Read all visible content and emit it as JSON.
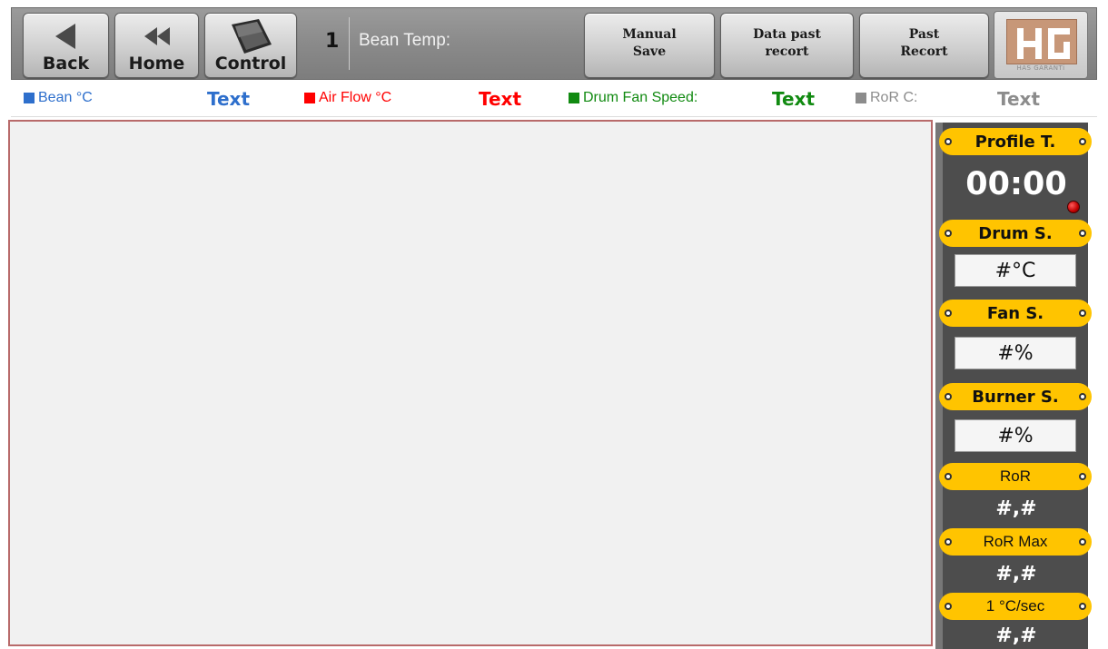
{
  "toolbar": {
    "back_label": "Back",
    "home_label": "Home",
    "control_label": "Control",
    "counter": "1",
    "bean_temp_label": "Bean Temp:",
    "manual_save_label": "Manual\nSave",
    "data_past_label": "Data past\nrecort",
    "past_record_label": "Past\nRecort",
    "logo_brand": "HAS GARANTi"
  },
  "legend": [
    {
      "label": "Bean °C",
      "value": "Text",
      "color": "#2e6fcc"
    },
    {
      "label": "Air Flow °C",
      "value": "Text",
      "color": "#ff0000"
    },
    {
      "label": "Drum Fan Speed:",
      "value": "Text",
      "color": "#118a11"
    },
    {
      "label": "RoR C:",
      "value": "Text",
      "color": "#8c8c8c"
    }
  ],
  "panel": {
    "profile_t_label": "Profile T.",
    "timer": "00:00",
    "drum_s_label": "Drum S.",
    "drum_s_value": "#°C",
    "fan_s_label": "Fan S.",
    "fan_s_value": "#%",
    "burner_s_label": "Burner S.",
    "burner_s_value": "#%",
    "ror_label": "RoR",
    "ror_value": "#,#",
    "ror_max_label": "RoR Max",
    "ror_max_value": "#,#",
    "rate_label": "1 °C/sec",
    "rate_value": "#,#"
  },
  "colors": {
    "accent_yellow": "#ffc400",
    "panel_bg": "#4d4d4d",
    "chart_border": "#b86a6a",
    "led_red": "#c00000"
  },
  "icons": [
    "back-arrow-icon",
    "home-double-arrow-icon",
    "tablet-icon",
    "hg-logo-icon"
  ]
}
